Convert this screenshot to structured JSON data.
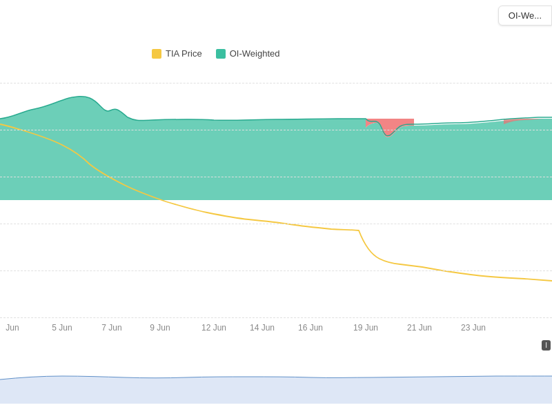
{
  "header": {
    "button_label": "OI-We..."
  },
  "legend": {
    "tia_label": "TIA Price",
    "oi_label": "OI-Weighted"
  },
  "x_axis": {
    "labels": [
      "Jun",
      "5 Jun",
      "7 Jun",
      "9 Jun",
      "12 Jun",
      "14 Jun",
      "16 Jun",
      "19 Jun",
      "21 Jun",
      "23 Jun"
    ]
  },
  "badge": {
    "text": "I"
  }
}
